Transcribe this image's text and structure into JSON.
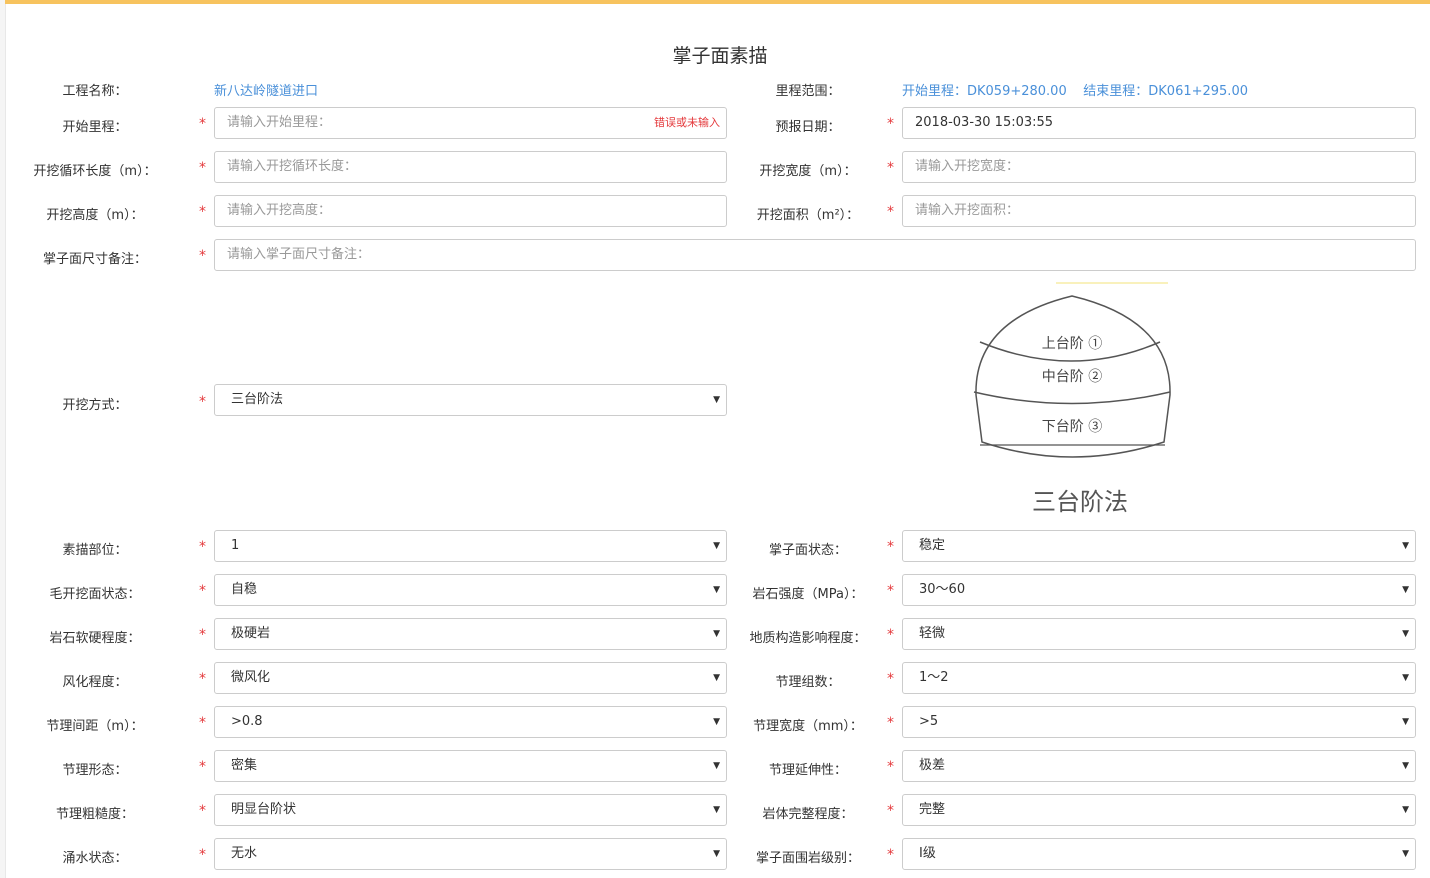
{
  "page": {
    "title": "掌子面素描"
  },
  "header_row": {
    "project_label": "工程名称：",
    "project_value": "新八达岭隧道进口",
    "range_label": "里程范围：",
    "range_value": "开始里程：DK059+280.00    结束里程：DK061+295.00"
  },
  "fields": {
    "start_mileage": {
      "label": "开始里程：",
      "placeholder": "请输入开始里程：",
      "error": "错误或未输入"
    },
    "report_date": {
      "label": "预报日期：",
      "value": "2018-03-30 15:03:55"
    },
    "cycle_length": {
      "label": "开挖循环长度（m）：",
      "placeholder": "请输入开挖循环长度："
    },
    "width": {
      "label": "开挖宽度（m）：",
      "placeholder": "请输入开挖宽度："
    },
    "height": {
      "label": "开挖高度（m）：",
      "placeholder": "请输入开挖高度："
    },
    "area": {
      "label": "开挖面积（m²）：",
      "placeholder": "请输入开挖面积："
    },
    "size_note": {
      "label": "掌子面尺寸备注：",
      "placeholder": "请输入掌子面尺寸备注："
    },
    "method": {
      "label": "开挖方式：",
      "value": "三台阶法"
    }
  },
  "diagram": {
    "upper": "上台阶 ①",
    "middle": "中台阶 ②",
    "lower": "下台阶 ③",
    "caption": "三台阶法"
  },
  "selects_left": [
    {
      "label": "素描部位：",
      "value": "1"
    },
    {
      "label": "毛开挖面状态：",
      "value": "自稳"
    },
    {
      "label": "岩石软硬程度：",
      "value": "极硬岩"
    },
    {
      "label": "风化程度：",
      "value": "微风化"
    },
    {
      "label": "节理间距（m）：",
      "value": ">0.8"
    },
    {
      "label": "节理形态：",
      "value": "密集"
    },
    {
      "label": "节理粗糙度：",
      "value": "明显台阶状"
    },
    {
      "label": "涌水状态：",
      "value": "无水"
    }
  ],
  "selects_right": [
    {
      "label": "掌子面状态：",
      "value": "稳定"
    },
    {
      "label": "岩石强度（MPa）：",
      "value": "30～60"
    },
    {
      "label": "地质构造影响程度：",
      "value": "轻微"
    },
    {
      "label": "节理组数：",
      "value": "1～2"
    },
    {
      "label": "节理宽度（mm）：",
      "value": ">5"
    },
    {
      "label": "节理延伸性：",
      "value": "极差"
    },
    {
      "label": "岩体完整程度：",
      "value": "完整"
    },
    {
      "label": "掌子面围岩级别：",
      "value": "Ⅰ级"
    }
  ],
  "required_mark": "*",
  "caret": "▼"
}
